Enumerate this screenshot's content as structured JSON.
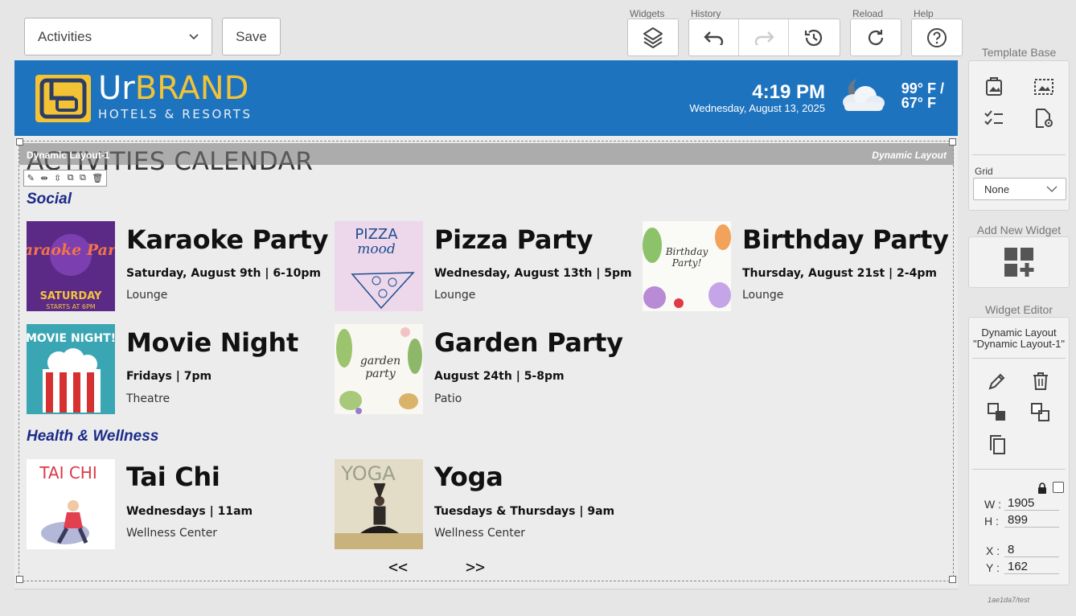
{
  "toolbar": {
    "page_select": "Activities",
    "save_label": "Save",
    "widgets_label": "Widgets",
    "history_label": "History",
    "reload_label": "Reload",
    "help_label": "Help"
  },
  "header": {
    "brand_main": "BRAND",
    "brand_prefix": "Ur",
    "brand_sub": "HOTELS & RESORTS",
    "time": "4:19 PM",
    "date": "Wednesday, August 13, 2025",
    "temp_high": "99° F /",
    "temp_low": "67° F",
    "weather_icon": "partly-cloudy-night-icon"
  },
  "layout": {
    "bar_left": "Dynamic Layout-1",
    "bar_right": "Dynamic Layout",
    "title": "ACTIVITIES CALENDAR"
  },
  "sections": [
    {
      "name": "Social",
      "events": [
        {
          "title": "Karaoke Party",
          "when": "Saturday, August 9th | 6-10pm",
          "where": "Lounge",
          "img_text": "Karaoke Party",
          "img_sub": "SATURDAY",
          "img_sub2": "STARTS AT 6PM"
        },
        {
          "title": "Pizza Party",
          "when": "Wednesday, August 13th | 5pm",
          "where": "Lounge",
          "img_text": "PIZZA",
          "img_sub": "mood"
        },
        {
          "title": "Birthday Party",
          "when": "Thursday, August 21st | 2-4pm",
          "where": "Lounge",
          "img_text": "Birthday",
          "img_sub": "Party!"
        },
        {
          "title": "Movie Night",
          "when": "Fridays | 7pm",
          "where": "Theatre",
          "img_text": "MOVIE NIGHT!"
        },
        {
          "title": "Garden Party",
          "when": "August 24th | 5-8pm",
          "where": "Patio",
          "img_text": "garden",
          "img_sub": "party"
        }
      ]
    },
    {
      "name": "Health & Wellness",
      "events": [
        {
          "title": "Tai Chi",
          "when": "Wednesdays | 11am",
          "where": "Wellness Center",
          "img_text": "TAI CHI"
        },
        {
          "title": "Yoga",
          "when": "Tuesdays & Thursdays | 9am",
          "where": "Wellness Center",
          "img_text": "YOGA"
        }
      ]
    }
  ],
  "pager": {
    "prev": "<<",
    "next": ">>"
  },
  "panel": {
    "template_base": "Template Base",
    "grid_label": "Grid",
    "grid_value": "None",
    "add_widget": "Add New Widget",
    "widget_editor": "Widget Editor",
    "editor_type": "Dynamic Layout",
    "editor_name": "\"Dynamic Layout-1\"",
    "w_label": "W :",
    "w_value": "1905",
    "h_label": "H :",
    "h_value": "899",
    "x_label": "X :",
    "x_value": "8",
    "y_label": "Y :",
    "y_value": "162"
  },
  "footer_id": "1ae1da7/test"
}
